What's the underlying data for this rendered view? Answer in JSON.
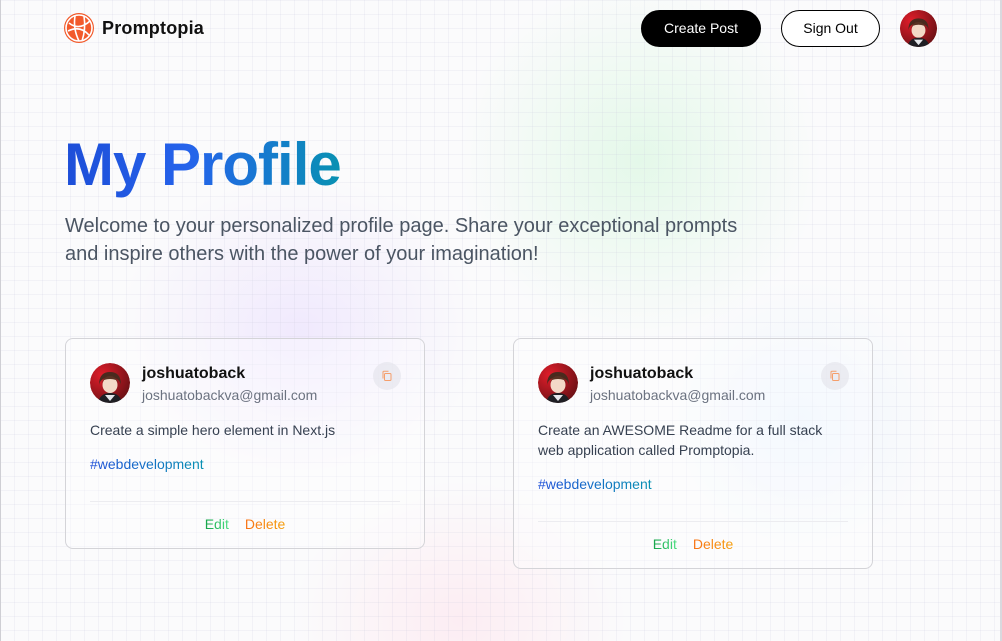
{
  "nav": {
    "brand": "Promptopia",
    "create_post": "Create Post",
    "sign_out": "Sign Out"
  },
  "hero": {
    "title": "My Profile",
    "description": "Welcome to your personalized profile page. Share your exceptional prompts and inspire others with the power of your imagination!"
  },
  "posts": [
    {
      "username": "joshuatoback",
      "email": "joshuatobackva@gmail.com",
      "prompt": "Create a simple hero element in Next.js",
      "tag": "#webdevelopment",
      "edit": "Edit",
      "delete": "Delete"
    },
    {
      "username": "joshuatoback",
      "email": "joshuatobackva@gmail.com",
      "prompt": "Create an AWESOME Readme for a full stack web application called Promptopia.",
      "tag": "#webdevelopment",
      "edit": "Edit",
      "delete": "Delete"
    }
  ],
  "colors": {
    "brand_logo": "#f25a2b",
    "title_gradient_start": "#1d4ed8",
    "title_gradient_end": "#0891b2",
    "edit": "#4ade80",
    "delete": "#f97316"
  }
}
